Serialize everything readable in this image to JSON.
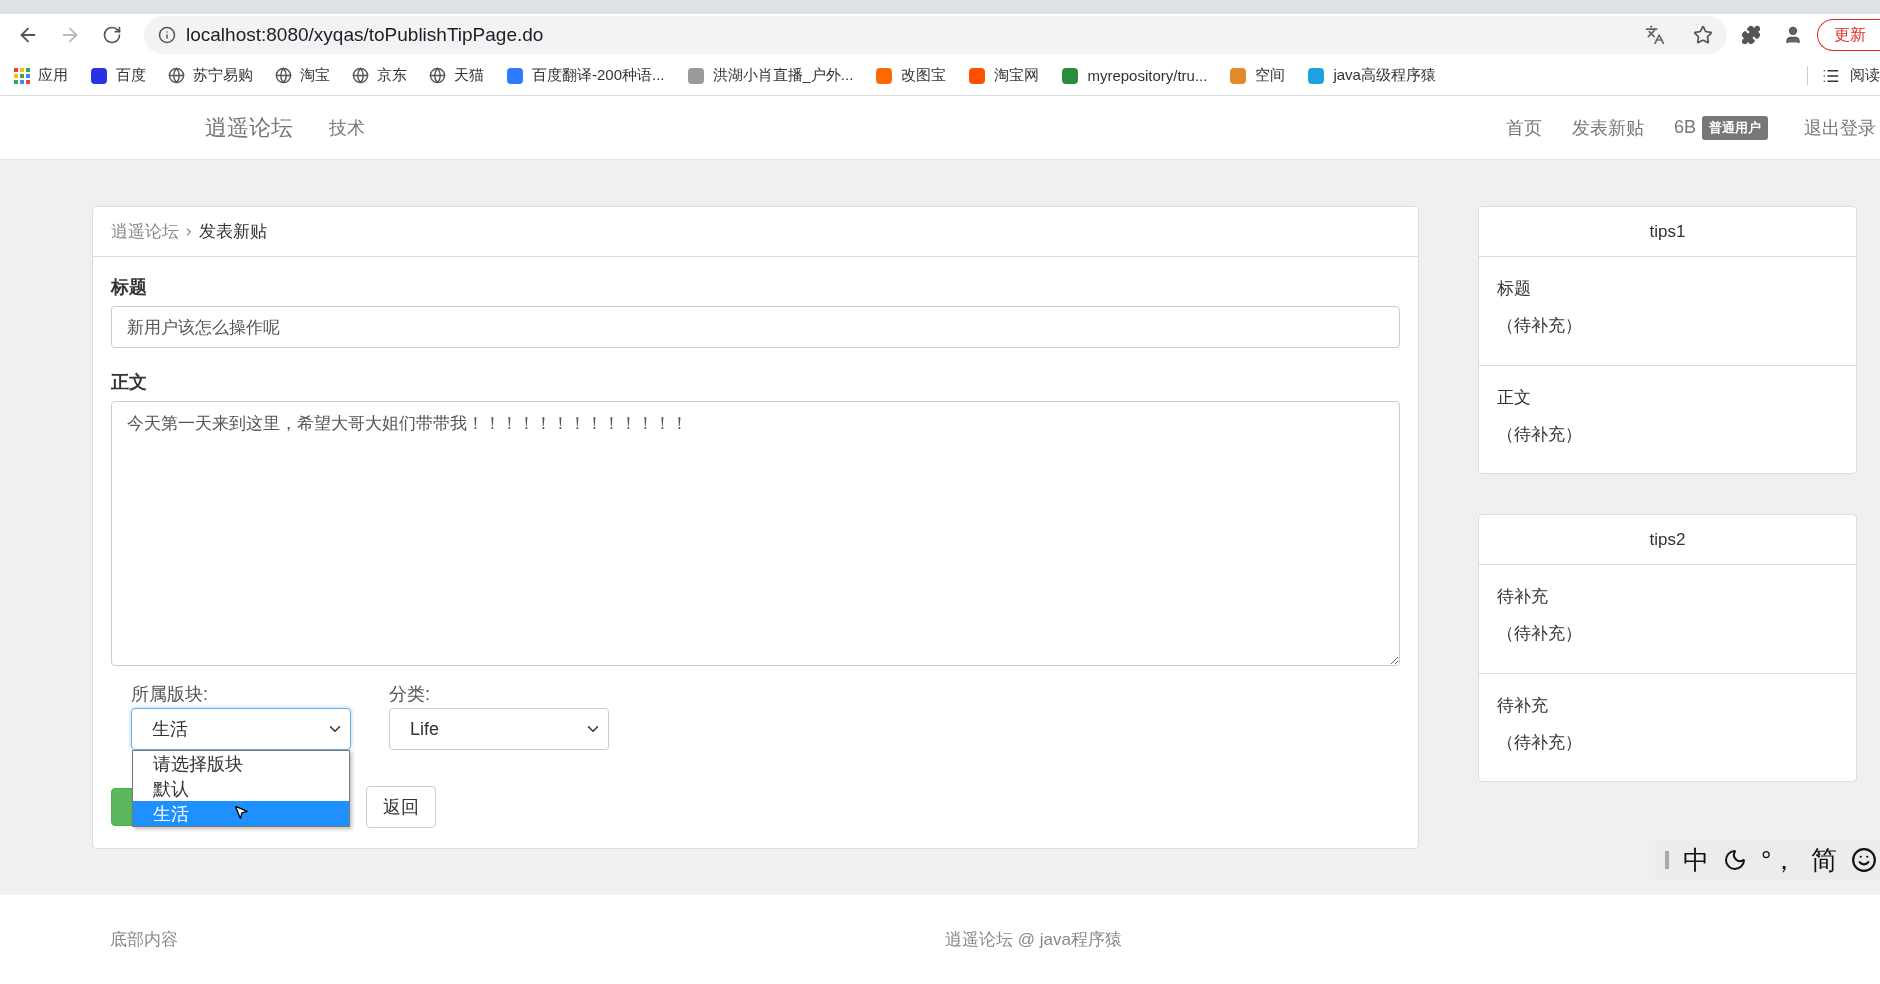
{
  "browser": {
    "address": "localhost:8080/xyqas/toPublishTipPage.do",
    "update_button": "更新",
    "bookmarks": [
      {
        "label": "应用"
      },
      {
        "label": "百度"
      },
      {
        "label": "苏宁易购"
      },
      {
        "label": "淘宝"
      },
      {
        "label": "京东"
      },
      {
        "label": "天猫"
      },
      {
        "label": "百度翻译-200种语..."
      },
      {
        "label": "洪湖小肖直播_户外..."
      },
      {
        "label": "改图宝"
      },
      {
        "label": "淘宝网"
      },
      {
        "label": "myrepository/tru..."
      },
      {
        "label": "空间"
      },
      {
        "label": "java高级程序猿"
      }
    ],
    "reading_list": "阅读"
  },
  "navbar": {
    "brand": "逍遥论坛",
    "links": [
      "技术"
    ],
    "right_links": [
      "首页",
      "发表新贴"
    ],
    "user": "6B",
    "user_badge": "普通用户",
    "logout": "退出登录"
  },
  "breadcrumb": {
    "parent": "逍遥论坛",
    "current": "发表新贴"
  },
  "form": {
    "title_label": "标题",
    "title_value": "新用户该怎么操作呢",
    "body_label": "正文",
    "body_value": "今天第一天来到这里，希望大哥大姐们带带我！！！！！！！！！！！！！",
    "section_select": {
      "label": "所属版块:",
      "value": "生活",
      "open": true,
      "options": [
        {
          "label": "请选择版块",
          "selected": false
        },
        {
          "label": "默认",
          "selected": false
        },
        {
          "label": "生活",
          "selected": true
        }
      ]
    },
    "category_select": {
      "label": "分类:",
      "value": "Life"
    },
    "back_button": "返回"
  },
  "tip_panels": [
    {
      "title": "tips1",
      "items": [
        {
          "label": "标题",
          "text": "（待补充）"
        },
        {
          "label": "正文",
          "text": "（待补充）"
        }
      ]
    },
    {
      "title": "tips2",
      "items": [
        {
          "label": "待补充",
          "text": "（待补充）"
        },
        {
          "label": "待补充",
          "text": "（待补充）"
        }
      ]
    }
  ],
  "ime_bar": {
    "mode": "中",
    "punctuation": "°，",
    "script": "简"
  },
  "footer": {
    "left": "底部内容",
    "center": "逍遥论坛 @ java程序猿"
  }
}
